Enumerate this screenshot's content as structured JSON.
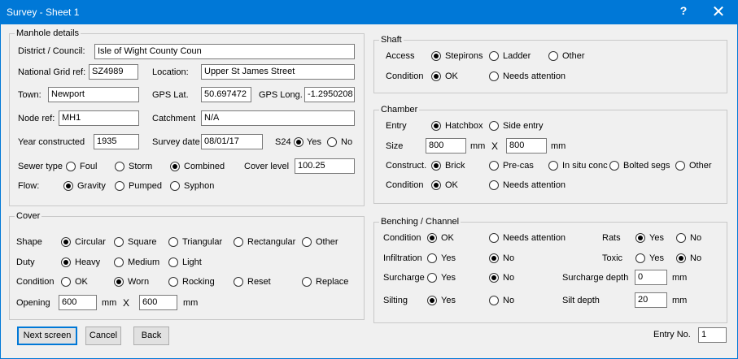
{
  "window": {
    "title": "Survey - Sheet 1",
    "help_glyph": "?",
    "close_glyph": "✕"
  },
  "manhole": {
    "legend": "Manhole details",
    "district_label": "District / Council:",
    "district_value": "Isle of Wight County Coun",
    "ngr_label": "National Grid ref:",
    "ngr_value": "SZ4989",
    "location_label": "Location:",
    "location_value": "Upper St James Street",
    "town_label": "Town:",
    "town_value": "Newport",
    "gps_lat_label": "GPS Lat.",
    "gps_lat_value": "50.697472",
    "gps_long_label": "GPS Long.",
    "gps_long_value": "-1.2950208",
    "node_label": "Node ref:",
    "node_value": "MH1",
    "catchment_label": "Catchment",
    "catchment_value": "N/A",
    "year_label": "Year constructed",
    "year_value": "1935",
    "survey_date_label": "Survey date",
    "survey_date_value": "08/01/17",
    "s24_label": "S24",
    "s24_yes": "Yes",
    "s24_no": "No",
    "sewer_type_label": "Sewer type",
    "sewer_foul": "Foul",
    "sewer_storm": "Storm",
    "sewer_combined": "Combined",
    "cover_level_label": "Cover level",
    "cover_level_value": "100.25",
    "flow_label": "Flow:",
    "flow_gravity": "Gravity",
    "flow_pumped": "Pumped",
    "flow_syphon": "Syphon"
  },
  "cover": {
    "legend": "Cover",
    "shape_label": "Shape",
    "shape_circular": "Circular",
    "shape_square": "Square",
    "shape_triangular": "Triangular",
    "shape_rectangular": "Rectangular",
    "shape_other": "Other",
    "duty_label": "Duty",
    "duty_heavy": "Heavy",
    "duty_medium": "Medium",
    "duty_light": "Light",
    "condition_label": "Condition",
    "cond_ok": "OK",
    "cond_worn": "Worn",
    "cond_rocking": "Rocking",
    "cond_reset": "Reset",
    "cond_replace": "Replace",
    "opening_label": "Opening",
    "opening_w": "600",
    "opening_unit1": "mm",
    "opening_x": "X",
    "opening_h": "600",
    "opening_unit2": "mm"
  },
  "shaft": {
    "legend": "Shaft",
    "access_label": "Access",
    "access_stepirons": "Stepirons",
    "access_ladder": "Ladder",
    "access_other": "Other",
    "condition_label": "Condition",
    "cond_ok": "OK",
    "cond_needs": "Needs attention"
  },
  "chamber": {
    "legend": "Chamber",
    "entry_label": "Entry",
    "entry_hatchbox": "Hatchbox",
    "entry_side": "Side entry",
    "size_label": "Size",
    "size_w": "800",
    "size_unit1": "mm",
    "size_x": "X",
    "size_h": "800",
    "size_unit2": "mm",
    "construct_label": "Construct.",
    "con_brick": "Brick",
    "con_precas": "Pre-cas",
    "con_insitu": "In situ conc",
    "con_bolted": "Bolted segs",
    "con_other": "Other",
    "condition_label": "Condition",
    "cond_ok": "OK",
    "cond_needs": "Needs attention"
  },
  "benching": {
    "legend": "Benching / Channel",
    "condition_label": "Condition",
    "cond_ok": "OK",
    "cond_needs": "Needs attention",
    "rats_label": "Rats",
    "rats_yes": "Yes",
    "rats_no": "No",
    "infiltration_label": "Infiltration",
    "inf_yes": "Yes",
    "inf_no": "No",
    "toxic_label": "Toxic",
    "toxic_yes": "Yes",
    "toxic_no": "No",
    "surcharge_label": "Surcharge",
    "sur_yes": "Yes",
    "sur_no": "No",
    "surcharge_depth_label": "Surcharge depth",
    "surcharge_depth_value": "0",
    "surcharge_depth_unit": "mm",
    "silting_label": "Silting",
    "silt_yes": "Yes",
    "silt_no": "No",
    "silt_depth_label": "Silt depth",
    "silt_depth_value": "20",
    "silt_depth_unit": "mm"
  },
  "buttons": {
    "next": "Next screen",
    "cancel": "Cancel",
    "back": "Back"
  },
  "entry_no": {
    "label": "Entry No.",
    "value": "1"
  }
}
